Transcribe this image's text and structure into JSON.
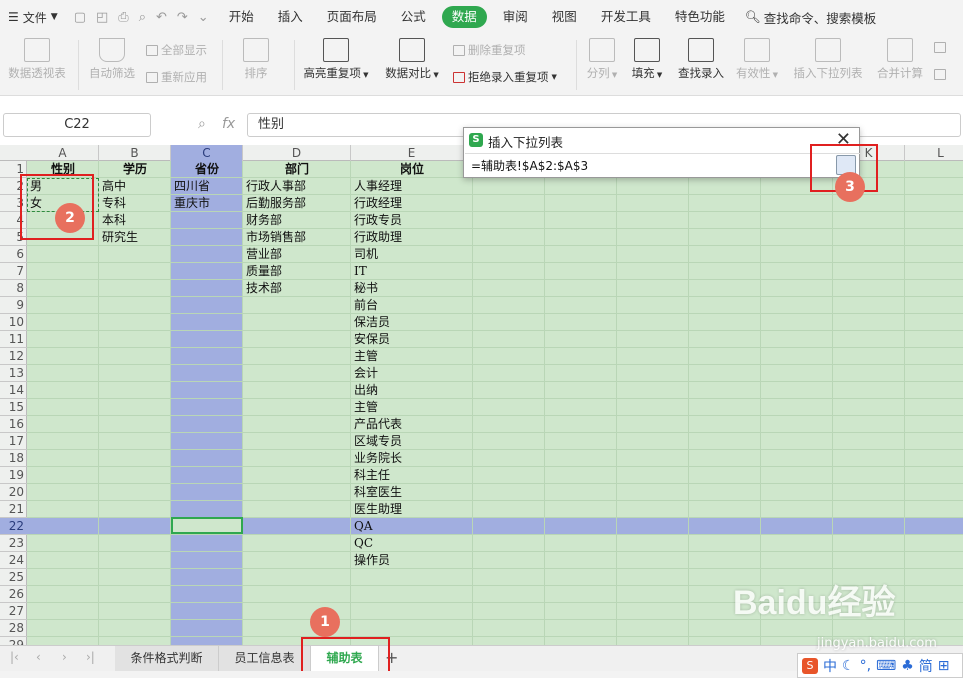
{
  "menubar": {
    "file_label": "文件",
    "tabs": [
      "开始",
      "插入",
      "页面布局",
      "公式",
      "数据",
      "审阅",
      "视图",
      "开发工具",
      "特色功能"
    ],
    "active_tab": "数据",
    "search_label": "查找命令、搜索模板"
  },
  "ribbon": {
    "pivot": "数据透视表",
    "autofilter": "自动筛选",
    "show_all": "全部显示",
    "reapply": "重新应用",
    "sort": "排序",
    "highlight_dup": "高亮重复项",
    "compare": "数据对比",
    "remove_dup": "删除重复项",
    "reject_dup": "拒绝录入重复项",
    "split": "分列",
    "fill": "填充",
    "lookup": "查找录入",
    "validity": "有效性",
    "insert_dropdown": "插入下拉列表",
    "consolidate": "合并计算"
  },
  "formula_bar": {
    "name_box": "C22",
    "fx_label": "fx",
    "formula": "性别"
  },
  "columns": [
    "A",
    "B",
    "C",
    "D",
    "E",
    "F",
    "G",
    "H",
    "I",
    "J",
    "K",
    "L"
  ],
  "rows": [
    "1",
    "2",
    "3",
    "4",
    "5",
    "6",
    "7",
    "8",
    "9",
    "10",
    "11",
    "12",
    "13",
    "14",
    "15",
    "16",
    "17",
    "18",
    "19",
    "20",
    "21",
    "22",
    "23",
    "24",
    "25",
    "26",
    "27",
    "28",
    "29"
  ],
  "headers": {
    "A": "性别",
    "B": "学历",
    "C": "省份",
    "D": "部门",
    "E": "岗位"
  },
  "col_a": [
    "男",
    "女"
  ],
  "col_b": [
    "高中",
    "专科",
    "本科",
    "研究生"
  ],
  "col_c": [
    "四川省",
    "重庆市"
  ],
  "col_d": [
    "行政人事部",
    "后勤服务部",
    "财务部",
    "市场销售部",
    "营业部",
    "质量部",
    "技术部"
  ],
  "col_e": [
    "人事经理",
    "行政经理",
    "行政专员",
    "行政助理",
    "司机",
    "IT",
    "秘书",
    "前台",
    "保洁员",
    "安保员",
    "主管",
    "会计",
    "出纳",
    "主管",
    "产品代表",
    "区域专员",
    "业务院长",
    "科主任",
    "科室医生",
    "医生助理",
    "QA",
    "QC",
    "操作员"
  ],
  "dialog": {
    "title": "插入下拉列表",
    "value": "=辅助表!$A$2:$A$3"
  },
  "sheet_tabs": [
    "条件格式判断",
    "员工信息表",
    "辅助表"
  ],
  "active_sheet": "辅助表",
  "annotations": [
    "1",
    "2",
    "3"
  ],
  "ime": {
    "items": [
      "中",
      "简"
    ]
  },
  "watermark": {
    "brand": "Baidu经验",
    "url": "jingyan.baidu.com"
  },
  "colors": {
    "accent": "#2fa84f",
    "selection": "#a1aee0",
    "cell_bg": "#cfe7cc",
    "annotation": "#e02020"
  }
}
